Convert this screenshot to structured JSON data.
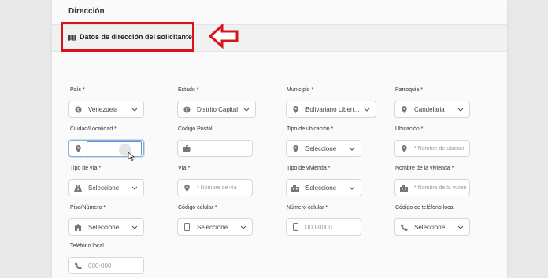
{
  "section": {
    "title": "Dirección"
  },
  "subsection": {
    "title": "Datos de dirección del solicitante",
    "icon": "map-icon"
  },
  "annotation": {
    "box_color": "#d8141b",
    "arrow_color": "#d8141b"
  },
  "fields": {
    "pais": {
      "label": "País *",
      "value": "Venezuela",
      "icon": "globe-icon"
    },
    "estado": {
      "label": "Estado *",
      "value": "Distrito Capital",
      "icon": "globe-icon"
    },
    "municipio": {
      "label": "Municipio *",
      "value": "Bolivariano Libert...",
      "icon": "location-pin-icon"
    },
    "parroquia": {
      "label": "Parroquia *",
      "value": "Candelaria",
      "icon": "location-pin-icon"
    },
    "ciudad": {
      "label": "Ciudad/Localidad *",
      "value": "",
      "icon": "location-pin-icon"
    },
    "codigo_postal": {
      "label": "Código Postal",
      "value": "",
      "icon": "mailbox-icon"
    },
    "tipo_ubicacion": {
      "label": "Tipo de ubicación *",
      "value": "Seleccione",
      "icon": "location-pin-icon"
    },
    "ubicacion": {
      "label": "Ubicación *",
      "placeholder": "* Nombre de ubicaci",
      "icon": "location-pin-icon"
    },
    "tipo_via": {
      "label": "Tipo de vía *",
      "value": "Seleccione",
      "icon": "road-icon"
    },
    "via": {
      "label": "Vía *",
      "placeholder": "* Nombre de vía",
      "icon": "location-pin-icon"
    },
    "tipo_vivienda": {
      "label": "Tipo de vivienda *",
      "value": "Seleccione",
      "icon": "building-icon"
    },
    "nombre_vivienda": {
      "label": "Nombre de la vivienda *",
      "placeholder": "* Nombre de la vivien",
      "icon": "building-icon"
    },
    "piso": {
      "label": "Piso/Número *",
      "value": "Seleccione",
      "icon": "home-icon"
    },
    "codigo_celular": {
      "label": "Código celular *",
      "value": "Seleccione",
      "icon": "mobile-icon"
    },
    "numero_celular": {
      "label": "Número celular *",
      "placeholder": "000-0000",
      "icon": "mobile-icon"
    },
    "codigo_telefono": {
      "label": "Código de teléfono local",
      "value": "Seleccione",
      "icon": "phone-icon"
    },
    "telefono_local": {
      "label": "Teléfono local",
      "placeholder": "000-000",
      "icon": "phone-icon"
    }
  }
}
